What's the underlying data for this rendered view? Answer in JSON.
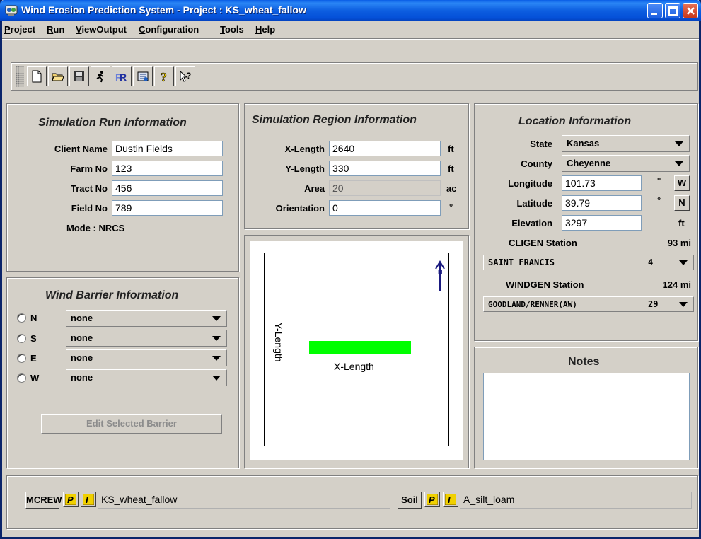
{
  "window": {
    "title": "Wind Erosion Prediction System - Project : KS_wheat_fallow"
  },
  "menu": [
    {
      "label": "Project",
      "underline": "P",
      "rest": "roject"
    },
    {
      "label": "Run",
      "underline": "R",
      "rest": "un"
    },
    {
      "label": "ViewOutput",
      "underline": "V",
      "rest": "iewOutput"
    },
    {
      "label": "Configuration",
      "underline": "C",
      "rest": "onfiguration"
    },
    {
      "label": "Tools",
      "underline": "T",
      "rest": "ools"
    },
    {
      "label": "Help",
      "underline": "H",
      "rest": "elp"
    }
  ],
  "toolbar": {
    "icons": [
      "new-file-icon",
      "open-folder-icon",
      "save-disk-icon",
      "run-figure-icon",
      "rerun-r-icon",
      "report-icon",
      "help-question-icon",
      "context-help-icon"
    ]
  },
  "simulation_run": {
    "title": "Simulation Run Information",
    "client_name_label": "Client Name",
    "client_name": "Dustin Fields",
    "farm_no_label": "Farm No",
    "farm_no": "123",
    "tract_no_label": "Tract No",
    "tract_no": "456",
    "field_no_label": "Field No",
    "field_no": "789",
    "mode": "Mode : NRCS"
  },
  "simulation_region": {
    "title": "Simulation Region Information",
    "x_length_label": "X-Length",
    "x_length": "2640",
    "x_length_unit": "ft",
    "y_length_label": "Y-Length",
    "y_length": "330",
    "y_length_unit": "ft",
    "area_label": "Area",
    "area": "20",
    "area_unit": "ac",
    "orientation_label": "Orientation",
    "orientation": "0",
    "orientation_unit": "°"
  },
  "location": {
    "title": "Location Information",
    "state_label": "State",
    "state": "Kansas",
    "county_label": "County",
    "county": "Cheyenne",
    "longitude_label": "Longitude",
    "longitude": "101.73",
    "longitude_dir": "W",
    "latitude_label": "Latitude",
    "latitude": "39.79",
    "latitude_dir": "N",
    "degree_symbol": "°",
    "elevation_label": "Elevation",
    "elevation": "3297",
    "elevation_unit": "ft",
    "cligen_label": "CLIGEN Station",
    "cligen_distance": "93 mi",
    "cligen_station": "SAINT FRANCIS",
    "cligen_num": "4",
    "windgen_label": "WINDGEN Station",
    "windgen_distance": "124 mi",
    "windgen_station": "GOODLAND/RENNER(AW)",
    "windgen_num": "29"
  },
  "wind_barrier": {
    "title": "Wind Barrier Information",
    "rows": [
      {
        "dir": "N",
        "value": "none"
      },
      {
        "dir": "S",
        "value": "none"
      },
      {
        "dir": "E",
        "value": "none"
      },
      {
        "dir": "W",
        "value": "none"
      }
    ],
    "edit_button": "Edit Selected Barrier"
  },
  "diagram": {
    "y_label": "Y-Length",
    "x_label": "X-Length",
    "north_label": "N",
    "field_color": "#00ff00"
  },
  "notes": {
    "title": "Notes",
    "text": ""
  },
  "bottom": {
    "mcrew_label": "MCREW",
    "mcrew_file": "KS_wheat_fallow",
    "soil_label": "Soil",
    "soil_file": "A_silt_loam"
  }
}
